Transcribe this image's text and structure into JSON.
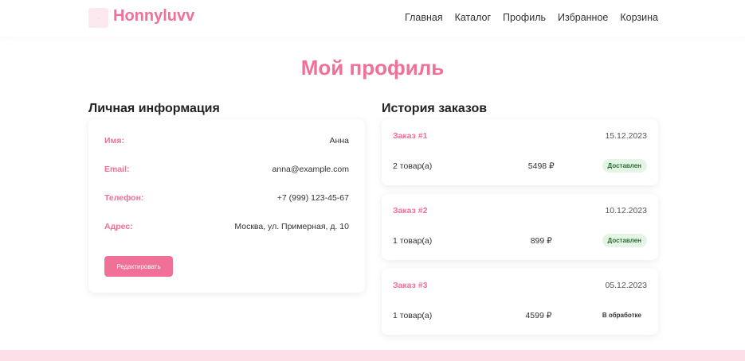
{
  "header": {
    "logo_text": "Honnyluvv",
    "logo_icon": "brand-logo-image",
    "nav": [
      "Главная",
      "Каталог",
      "Профиль",
      "Избранное",
      "Корзина"
    ]
  },
  "page": {
    "title": "Мой профиль"
  },
  "personal": {
    "title": "Личная информация",
    "rows": [
      {
        "label": "Имя:",
        "value": "Анна"
      },
      {
        "label": "Email:",
        "value": "anna@example.com"
      },
      {
        "label": "Телефон:",
        "value": "+7 (999) 123-45-67"
      },
      {
        "label": "Адрес:",
        "value": "Москва, ул. Примерная, д. 10"
      }
    ],
    "edit_label": "Редактировать"
  },
  "orders": {
    "title": "История заказов",
    "items": [
      {
        "number": "Заказ #1",
        "date": "15.12.2023",
        "items": "2 товар(а)",
        "price": "5498 ₽",
        "status": "Доставлен",
        "status_type": "delivered"
      },
      {
        "number": "Заказ #2",
        "date": "10.12.2023",
        "items": "1 товар(а)",
        "price": "899 ₽",
        "status": "Доставлен",
        "status_type": "delivered"
      },
      {
        "number": "Заказ #3",
        "date": "05.12.2023",
        "items": "1 товар(а)",
        "price": "4599 ₽",
        "status": "В обработке",
        "status_type": "processing"
      }
    ]
  },
  "colors": {
    "accent": "#f07098",
    "delivered_bg": "#e4f5e6",
    "footer": "#fbe0e8"
  }
}
